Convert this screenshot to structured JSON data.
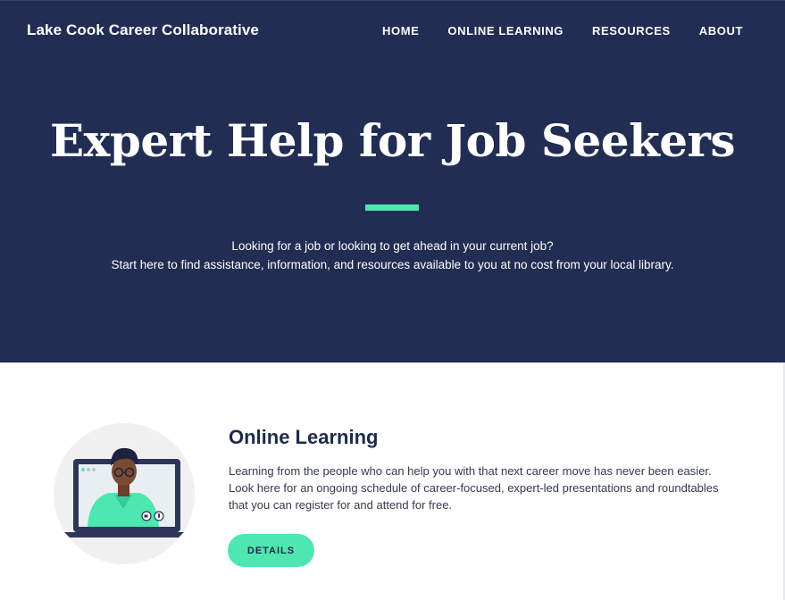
{
  "header": {
    "brand": "Lake Cook Career Collaborative",
    "nav": [
      {
        "label": "HOME"
      },
      {
        "label": "ONLINE LEARNING"
      },
      {
        "label": "RESOURCES"
      },
      {
        "label": "ABOUT"
      }
    ]
  },
  "hero": {
    "title": "Expert Help for Job Seekers",
    "subtitle_line1": "Looking for a job or looking to get ahead in your current job?",
    "subtitle_line2": "Start here to find assistance, information, and resources available to you at no cost from your local library."
  },
  "online_learning": {
    "illustration_icon": "laptop-video-call-person-icon",
    "title": "Online Learning",
    "body": "Learning from the people who can help you with that next career move has never been easier. Look here for an ongoing schedule of career-focused, expert-led presentations and roundtables that you can register for and attend for free.",
    "button_label": "DETAILS"
  },
  "colors": {
    "navy": "#212d52",
    "accent": "#4ee7b0",
    "heading": "#1e2a4a"
  }
}
